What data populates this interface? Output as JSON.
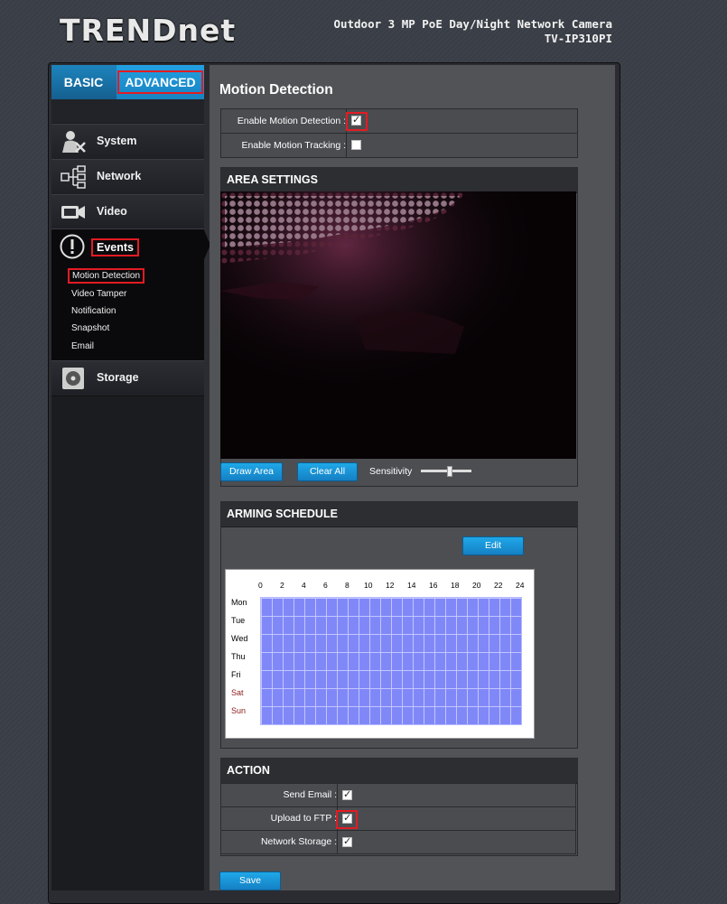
{
  "header": {
    "logo": "TRENDnet",
    "product_name": "Outdoor 3 MP PoE Day/Night Network Camera",
    "model": "TV-IP310PI"
  },
  "tabs": {
    "basic": "BASIC",
    "advanced": "ADVANCED"
  },
  "sidebar": {
    "items": [
      {
        "label": "System",
        "icon": "system-icon"
      },
      {
        "label": "Network",
        "icon": "network-icon"
      },
      {
        "label": "Video",
        "icon": "video-icon"
      },
      {
        "label": "Events",
        "icon": "events-icon"
      },
      {
        "label": "Storage",
        "icon": "storage-icon"
      }
    ],
    "events_sub": [
      "Motion Detection",
      "Video Tamper",
      "Notification",
      "Snapshot",
      "Email"
    ]
  },
  "page": {
    "title": "Motion Detection",
    "enable_motion_detection": {
      "label": "Enable Motion Detection :",
      "checked": true
    },
    "enable_motion_tracking": {
      "label": "Enable Motion Tracking :",
      "checked": false
    }
  },
  "area_settings": {
    "heading": "AREA SETTINGS",
    "draw_area": "Draw Area",
    "clear_all": "Clear All",
    "sensitivity_label": "Sensitivity",
    "sensitivity_level": 0.55
  },
  "arming_schedule": {
    "heading": "ARMING SCHEDULE",
    "edit": "Edit",
    "hours": [
      "0",
      "2",
      "4",
      "6",
      "8",
      "10",
      "12",
      "14",
      "16",
      "18",
      "20",
      "22",
      "24"
    ],
    "days": [
      "Mon",
      "Tue",
      "Wed",
      "Thu",
      "Fri",
      "Sat",
      "Sun"
    ],
    "weekend_color": "#8b1a1a",
    "grid_color": "#8088f8"
  },
  "action": {
    "heading": "ACTION",
    "rows": [
      {
        "label": "Send Email :",
        "checked": true
      },
      {
        "label": "Upload to FTP :",
        "checked": true
      },
      {
        "label": "Network Storage :",
        "checked": true
      }
    ]
  },
  "save": "Save",
  "colors": {
    "accent": "#1a8fd4",
    "highlight": "#e31b23"
  }
}
